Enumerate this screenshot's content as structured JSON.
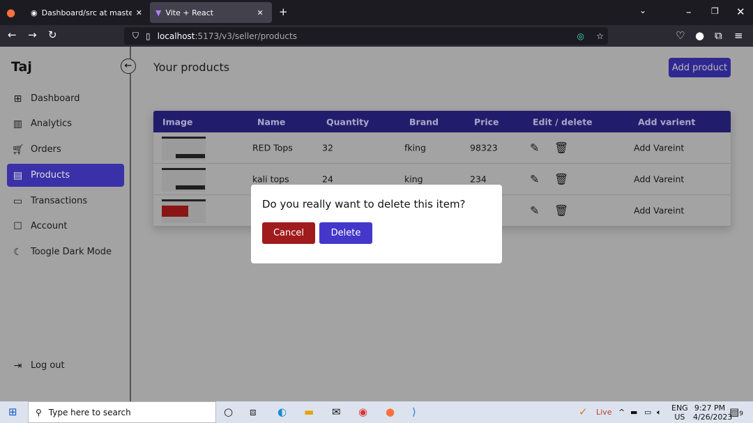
{
  "browser": {
    "tabs": [
      {
        "label": "Dashboard/src at master · Hayat"
      },
      {
        "label": "Vite + React"
      }
    ],
    "url_host": "localhost",
    "url_path": ":5173/v3/seller/products"
  },
  "sidebar": {
    "brand": "Taj",
    "items": [
      {
        "label": "Dashboard",
        "icon": "dashboard-icon"
      },
      {
        "label": "Analytics",
        "icon": "chart-icon"
      },
      {
        "label": "Orders",
        "icon": "cart-icon"
      },
      {
        "label": "Products",
        "icon": "box-icon",
        "active": true
      },
      {
        "label": "Transactions",
        "icon": "card-icon"
      },
      {
        "label": "Account",
        "icon": "user-icon"
      },
      {
        "label": "Toogle Dark Mode",
        "icon": "moon-icon"
      }
    ],
    "logout": "Log out"
  },
  "main": {
    "title": "Your products",
    "add_button": "Add product"
  },
  "table": {
    "headers": [
      "Image",
      "Name",
      "Quantity",
      "Brand",
      "Price",
      "Edit / delete",
      "Add varient"
    ],
    "rows": [
      {
        "name": "RED Tops",
        "quantity": "32",
        "brand": "fking",
        "price": "98323",
        "variant": "Add Vareint"
      },
      {
        "name": "kali tops",
        "quantity": "24",
        "brand": "king",
        "price": "234",
        "variant": "Add Vareint"
      },
      {
        "name": "",
        "quantity": "",
        "brand": "",
        "price": "",
        "variant": "Add Vareint"
      }
    ]
  },
  "modal": {
    "message": "Do you really want to delete this item?",
    "cancel": "Cancel",
    "delete": "Delete",
    "cancel_color": "#a01c1c",
    "delete_color": "#4338ca"
  },
  "taskbar": {
    "search_placeholder": "Type here to search",
    "live": "Live",
    "lang1": "ENG",
    "lang2": "US",
    "time": "9:27 PM",
    "date": "4/26/2023",
    "notifications": "9"
  }
}
